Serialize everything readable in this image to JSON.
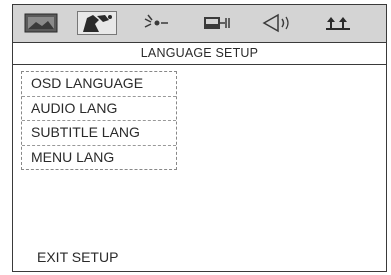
{
  "toolbar": {
    "icons": [
      "general-setup-icon",
      "speaker-setup-icon",
      "video-setup-icon",
      "preference-icon",
      "audio-setup-icon",
      "password-icon"
    ],
    "selected_index": 1
  },
  "header": {
    "title": "LANGUAGE SETUP"
  },
  "menu": {
    "items": [
      {
        "label": "OSD LANGUAGE"
      },
      {
        "label": "AUDIO LANG"
      },
      {
        "label": "SUBTITLE LANG"
      },
      {
        "label": "MENU LANG"
      }
    ]
  },
  "footer": {
    "exit_label": "EXIT SETUP"
  }
}
